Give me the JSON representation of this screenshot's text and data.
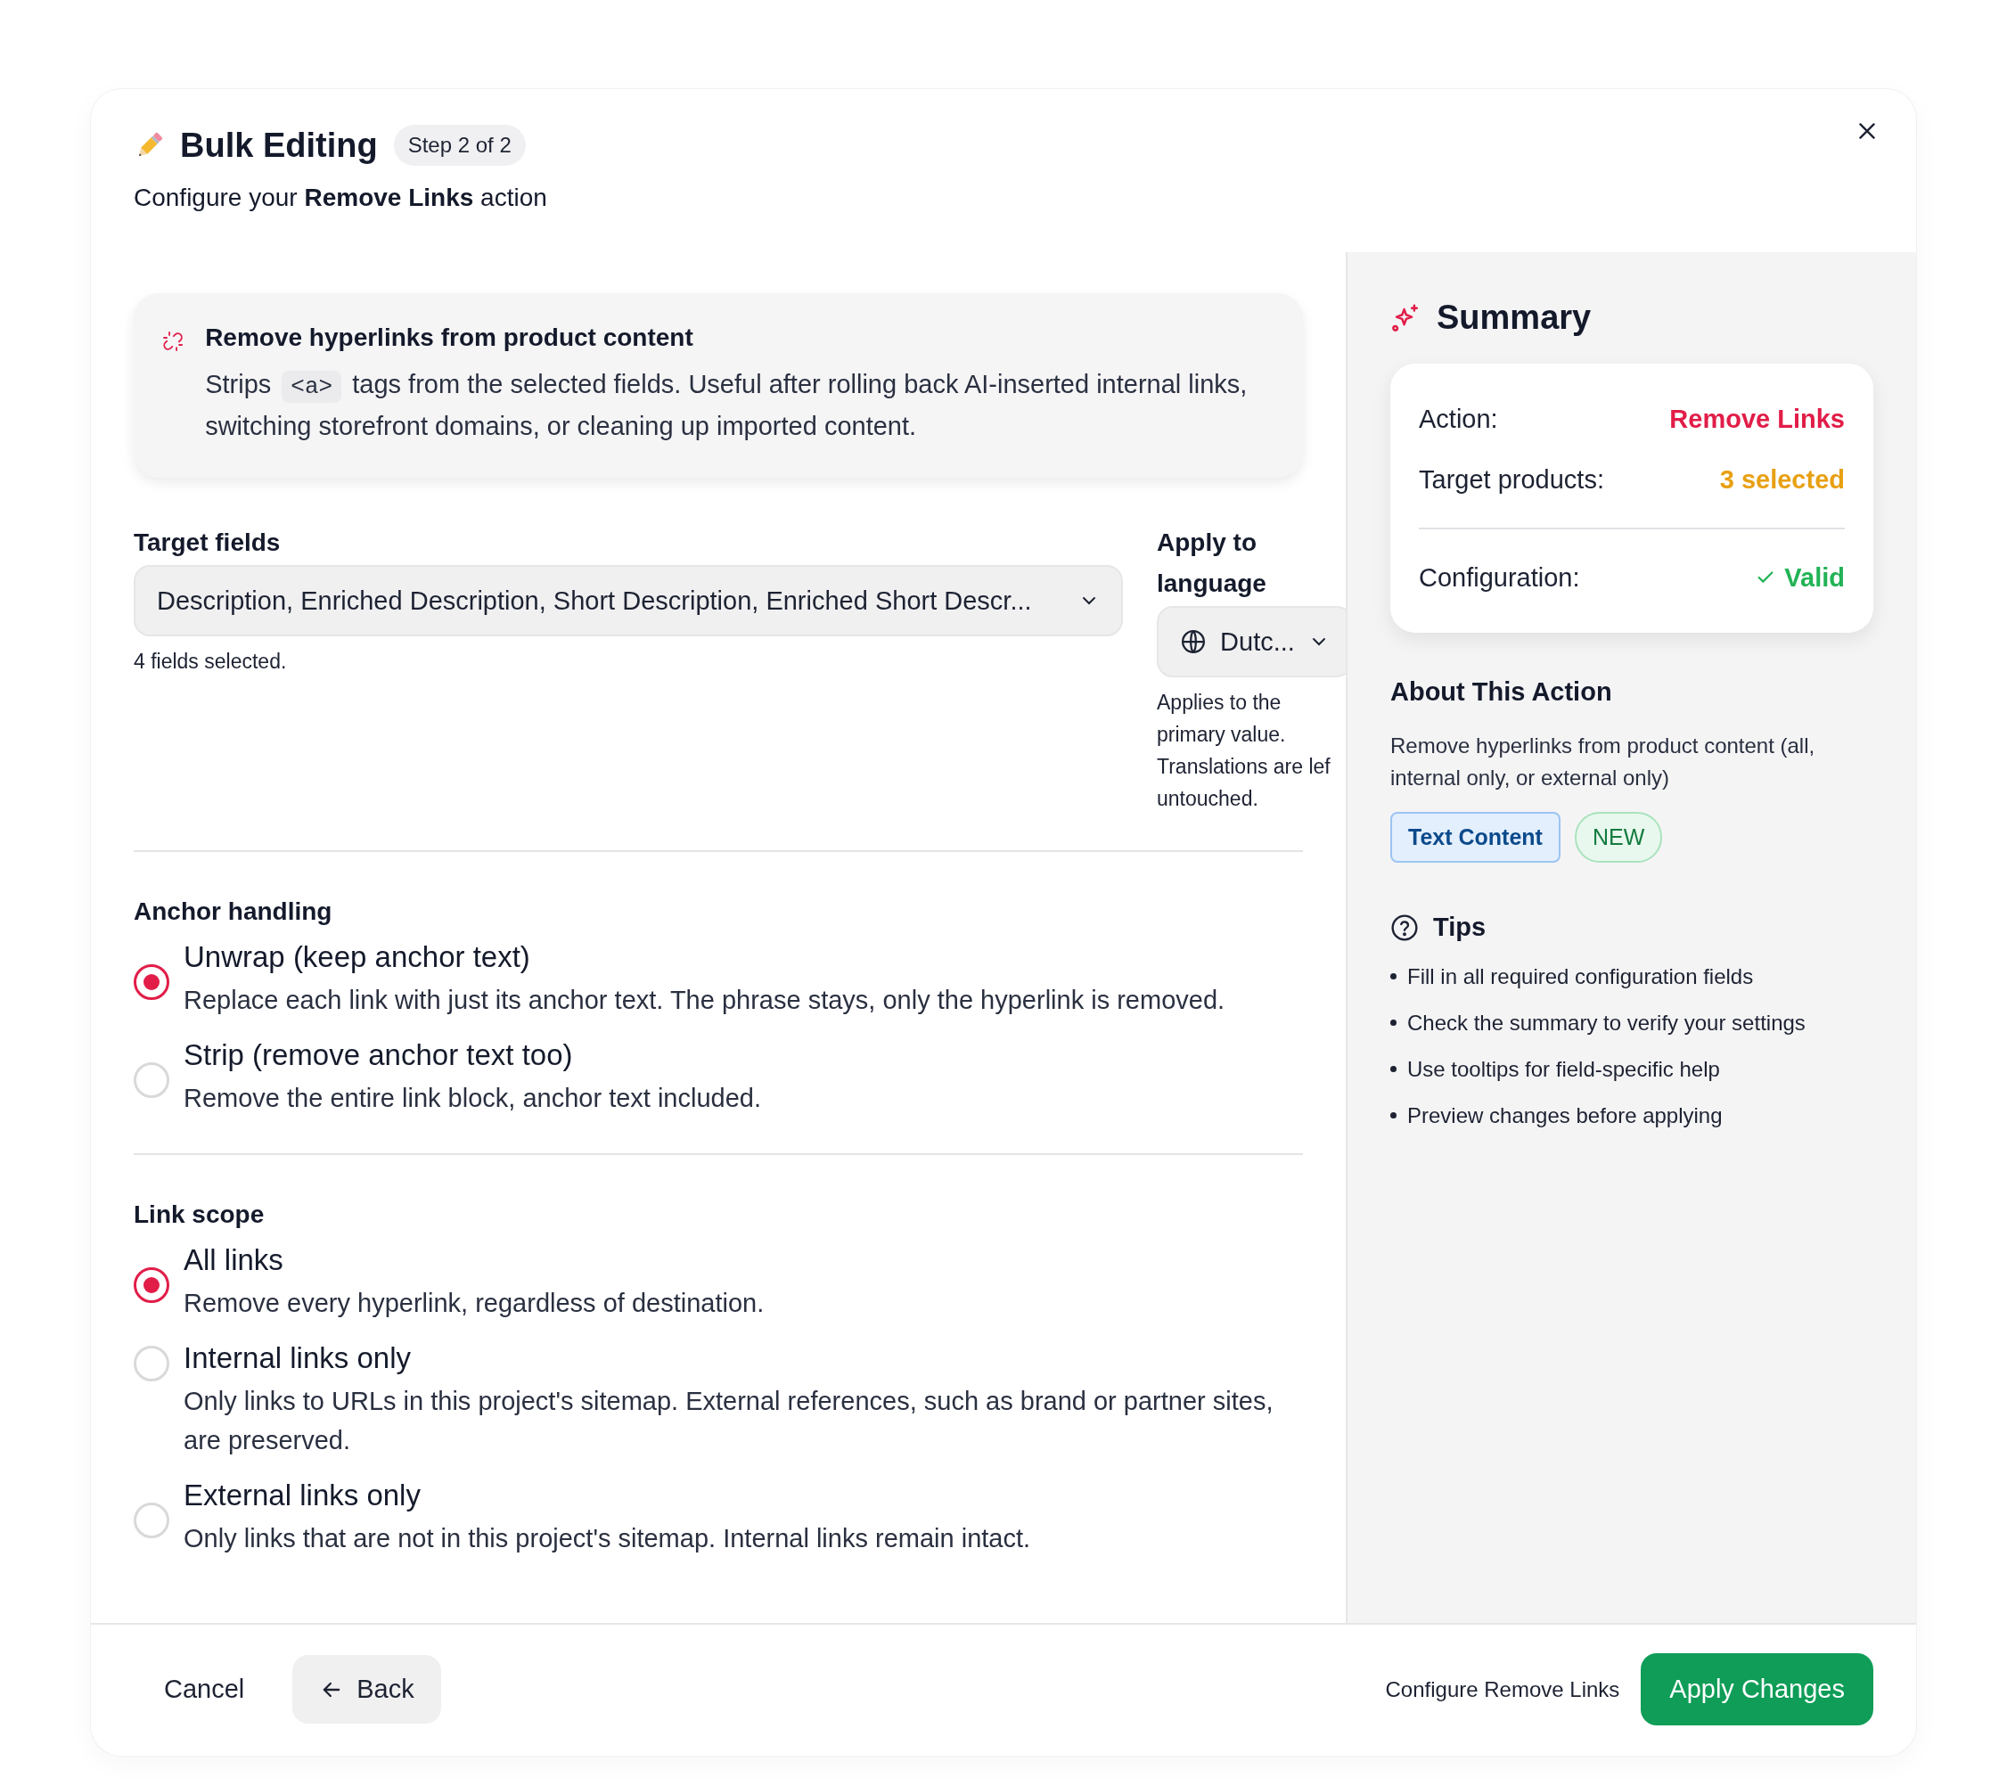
{
  "header": {
    "title": "Bulk Editing",
    "step_badge": "Step 2 of 2",
    "subtitle": "Configure your **Remove Links** action"
  },
  "info_card": {
    "title": "Remove hyperlinks from product content",
    "text_before": "Strips",
    "code": "<a>",
    "text_after": "tags from the selected fields. Useful after rolling back AI-inserted internal links, switching storefront domains, or cleaning up imported content."
  },
  "target_fields": {
    "label": "Target fields",
    "value": "Description, Enriched Description, Short Description, Enriched Short Descr...",
    "hint": "4 fields selected."
  },
  "language": {
    "label": "Apply to language",
    "value": "Dutc...",
    "hint": "Applies to the primary value. Translations are lef untouched."
  },
  "anchor_handling": {
    "label": "Anchor handling",
    "options": [
      {
        "title": "Unwrap (keep anchor text)",
        "description": "Replace each link with just its anchor text. The phrase stays, only the hyperlink is removed.",
        "selected": true
      },
      {
        "title": "Strip (remove anchor text too)",
        "description": "Remove the entire link block, anchor text included.",
        "selected": false
      }
    ]
  },
  "link_scope": {
    "label": "Link scope",
    "options": [
      {
        "title": "All links",
        "description": "Remove every hyperlink, regardless of destination.",
        "selected": true
      },
      {
        "title": "Internal links only",
        "description": "Only links to URLs in this project's sitemap. External references, such as brand or partner sites, are preserved.",
        "selected": false
      },
      {
        "title": "External links only",
        "description": "Only links that are not in this project's sitemap. Internal links remain intact.",
        "selected": false
      }
    ]
  },
  "summary": {
    "title": "Summary",
    "rows": [
      {
        "label": "Action:",
        "value": "Remove Links",
        "kind": "action"
      },
      {
        "label": "Target products:",
        "value": "3 selected",
        "kind": "count"
      },
      {
        "label": "Configuration:",
        "value": "Valid",
        "kind": "status"
      }
    ]
  },
  "about": {
    "title": "About This Action",
    "text": "Remove hyperlinks from product content (all, internal only, or external only)",
    "tags": [
      {
        "label": "Text Content",
        "kind": "category"
      },
      {
        "label": "NEW",
        "kind": "new"
      }
    ]
  },
  "tips": {
    "title": "Tips",
    "items": [
      "Fill in all required configuration fields",
      "Check the summary to verify your settings",
      "Use tooltips for field-specific help",
      "Preview changes before applying"
    ]
  },
  "footer": {
    "cancel": "Cancel",
    "back": "Back",
    "hint": "Configure Remove Links",
    "apply": "Apply Changes"
  }
}
